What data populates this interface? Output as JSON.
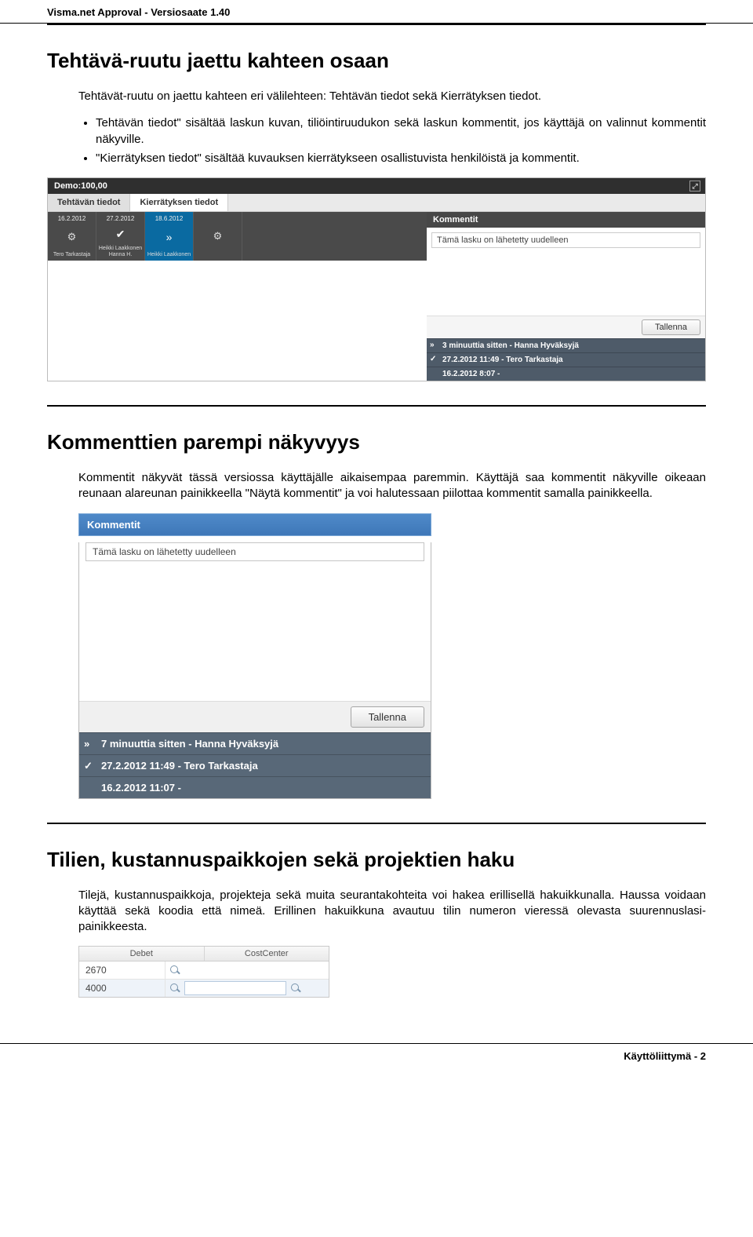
{
  "doc_header": "Visma.net Approval - Versiosaate 1.40",
  "section1": {
    "title": "Tehtävä-ruutu jaettu kahteen osaan",
    "intro": "Tehtävät-ruutu on jaettu kahteen eri välilehteen: Tehtävän tiedot sekä Kierrätyksen tiedot.",
    "bullets": [
      "Tehtävän tiedot\" sisältää laskun kuvan, tiliöintiruudukon sekä laskun kommentit, jos käyttäjä on valinnut kommentit näkyville.",
      "\"Kierrätyksen tiedot\" sisältää kuvauksen kierrätykseen osallistuvista henkilöistä ja kommentit."
    ]
  },
  "shot1": {
    "title_bar": "Demo:100,00",
    "tabs": [
      "Tehtävän tiedot",
      "Kierrätyksen tiedot"
    ],
    "workflow": [
      {
        "date": "16.2.2012",
        "name": "Tero Tarkastaja",
        "kind": "gear"
      },
      {
        "date": "27.2.2012",
        "name": "Heikki Laakkonen\nHanna H.",
        "kind": "check"
      },
      {
        "date": "18.6.2012",
        "name": "Heikki Laakkonen",
        "kind": "fwd",
        "selected": true
      },
      {
        "date": "",
        "name": "",
        "kind": "gear"
      }
    ],
    "comments_header": "Kommentit",
    "comment_input": "Tämä lasku on lähetetty uudelleen",
    "save_button": "Tallenna",
    "history": [
      {
        "icon": "»",
        "text": "3 minuuttia sitten - Hanna Hyväksyjä"
      },
      {
        "icon": "✓",
        "text": "27.2.2012 11:49 - Tero Tarkastaja"
      },
      {
        "icon": "",
        "text": "16.2.2012 8:07 -"
      }
    ]
  },
  "section2": {
    "title": "Kommenttien parempi näkyvyys",
    "text": "Kommentit näkyvät tässä versiossa käyttäjälle aikaisempaa paremmin. Käyttäjä saa kommentit näkyville oikeaan reunaan alareunan painikkeella \"Näytä kommentit\" ja voi halutessaan piilottaa kommentit samalla painikkeella."
  },
  "shot2": {
    "header": "Kommentit",
    "input": "Tämä lasku on lähetetty uudelleen",
    "save_button": "Tallenna",
    "history": [
      {
        "icon": "»",
        "text": "7 minuuttia sitten - Hanna Hyväksyjä"
      },
      {
        "icon": "✓",
        "text": "27.2.2012 11:49 - Tero Tarkastaja"
      },
      {
        "icon": "",
        "text": "16.2.2012 11:07 -"
      }
    ]
  },
  "section3": {
    "title": "Tilien, kustannuspaikkojen sekä projektien haku",
    "text": "Tilejä, kustannuspaikkoja, projekteja sekä muita seurantakohteita voi hakea erillisellä hakuikkunalla. Haussa voidaan käyttää sekä koodia että nimeä. Erillinen hakuikkuna avautuu tilin numeron vieressä olevasta suurennuslasi-painikkeesta."
  },
  "shot3": {
    "headers": [
      "Debet",
      "CostCenter"
    ],
    "rows": [
      {
        "debet": "2670",
        "cc": ""
      },
      {
        "debet": "4000",
        "cc": ""
      }
    ]
  },
  "footer": "Käyttöliittymä - 2"
}
